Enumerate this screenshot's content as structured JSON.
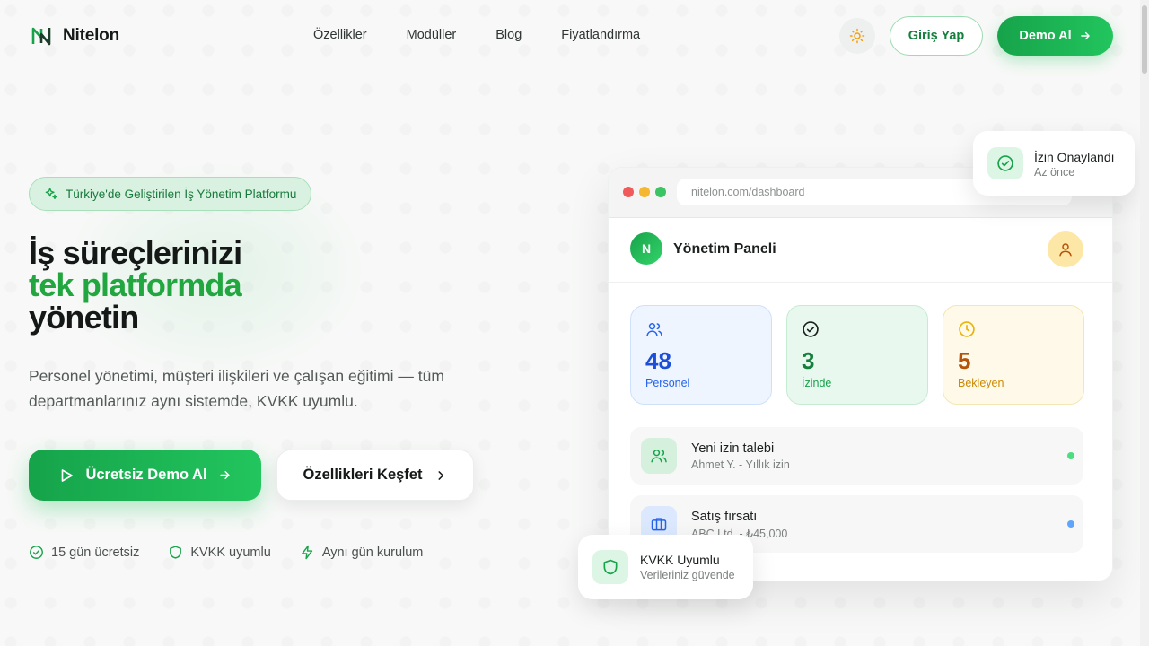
{
  "brand": {
    "name": "Nitelon",
    "accent": "#22c55e"
  },
  "nav": {
    "links": [
      "Özellikler",
      "Modüller",
      "Blog",
      "Fiyatlandırma"
    ],
    "theme_icon": "sun-icon",
    "login_label": "Giriş Yap",
    "demo_label": "Demo Al"
  },
  "hero": {
    "badge": "Türkiye'de Geliştirilen İş Yönetim Platformu",
    "title_line1": "İş süreçlerinizi",
    "title_line2": "tek platformda",
    "title_line3": "yönetin",
    "description": "Personel yönetimi, müşteri ilişkileri ve çalışan eğitimi — tüm departmanlarınız aynı sistemde, KVKK uyumlu.",
    "cta_primary": "Ücretsiz Demo Al",
    "cta_secondary": "Özellikleri Keşfet",
    "features": [
      "15 gün ücretsiz",
      "KVKK uyumlu",
      "Aynı gün kurulum"
    ]
  },
  "dashboard": {
    "url": "nitelon.com/dashboard",
    "avatar_letter": "N",
    "title": "Yönetim Paneli",
    "stats": [
      {
        "value": "48",
        "label": "Personel",
        "color": "#1d4ed8"
      },
      {
        "value": "3",
        "label": "İzinde",
        "color": "#15803d"
      },
      {
        "value": "5",
        "label": "Bekleyen",
        "color": "#b45309"
      }
    ],
    "rows": [
      {
        "title": "Yeni izin talebi",
        "subtitle": "Ahmet Y. - Yıllık izin"
      },
      {
        "title": "Satış fırsatı",
        "subtitle": "ABC Ltd. - ₺45,000"
      }
    ]
  },
  "floating": {
    "top_title": "İzin Onaylandı",
    "top_sub": "Az önce",
    "bottom_title": "KVKK Uyumlu",
    "bottom_sub": "Verileriniz güvende"
  }
}
